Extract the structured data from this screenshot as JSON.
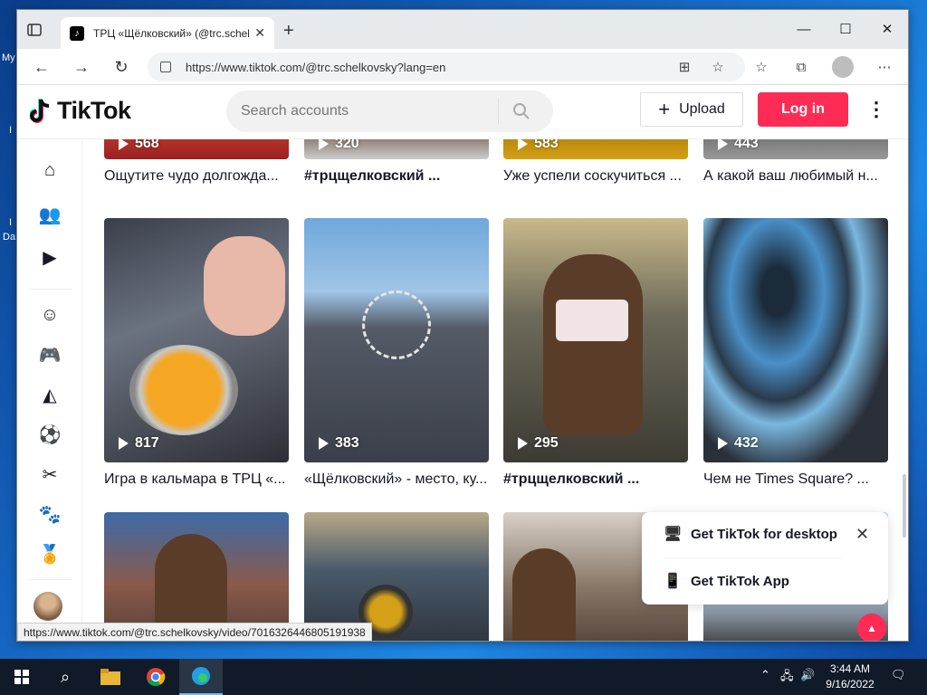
{
  "desktop": {
    "labels": [
      "My",
      "I",
      "Da",
      "I"
    ]
  },
  "browser": {
    "tab_title": "ТРЦ «Щёлковский» (@trc.schelk",
    "tab_favicon": "♪",
    "new_tab": "+",
    "url": "https://www.tiktok.com/@trc.schelkovsky?lang=en",
    "status_url": "https://www.tiktok.com/@trc.schelkovsky/video/7016326446805191938"
  },
  "header": {
    "logo_text": "TikTok",
    "search_placeholder": "Search accounts",
    "upload_label": "Upload",
    "login_label": "Log in"
  },
  "videos_top": [
    {
      "views": "568",
      "caption": "Ощутите чудо долгожда...",
      "bold": false
    },
    {
      "views": "320",
      "caption": "#трцщелковский ...",
      "bold": true
    },
    {
      "views": "583",
      "caption": "Уже успели соскучиться ...",
      "bold": false
    },
    {
      "views": "443",
      "caption": "А какой ваш любимый н...",
      "bold": false
    }
  ],
  "videos_mid": [
    {
      "views": "817",
      "caption": "Игра в кальмара в ТРЦ «...",
      "bold": false
    },
    {
      "views": "383",
      "caption": "«Щёлковский» - место, ку...",
      "bold": false
    },
    {
      "views": "295",
      "caption": "#трцщелковский ...",
      "bold": true
    },
    {
      "views": "432",
      "caption": "Чем не Times Square? ...",
      "bold": false
    }
  ],
  "popup": {
    "desktop_label": "Get TikTok for desktop",
    "app_label": "Get TikTok App"
  },
  "taskbar": {
    "time": "3:44 AM",
    "date": "9/16/2022"
  }
}
